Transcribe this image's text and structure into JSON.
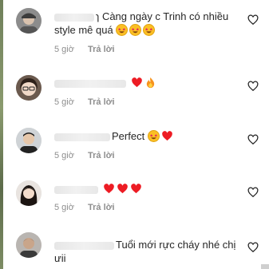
{
  "comments": [
    {
      "text": "ɿ Càng ngày c Trinh có nhiều style mê quá",
      "emojis": [
        "star-struck-emoji",
        "star-struck-emoji",
        "star-struck-emoji"
      ],
      "time": "5 giờ",
      "reply": "Trả lời",
      "avatar": "avatar-gray-cap"
    },
    {
      "text": "",
      "emojis": [
        "red-heart-emoji",
        "fire-emoji"
      ],
      "time": "5 giờ",
      "reply": "Trả lời",
      "avatar": "avatar-woman-glasses"
    },
    {
      "text": "Perfect",
      "emojis": [
        "star-struck-emoji",
        "red-heart-emoji"
      ],
      "time": "5 giờ",
      "reply": "Trả lời",
      "avatar": "avatar-man"
    },
    {
      "text": "",
      "emojis": [
        "red-heart-emoji",
        "red-heart-emoji",
        "red-heart-emoji"
      ],
      "time": "5 giờ",
      "reply": "Trả lời",
      "avatar": "avatar-woman-longhair"
    },
    {
      "text": "Tuổi mới rực cháy nhé chị ưii",
      "emojis": [],
      "time": "",
      "reply": "",
      "avatar": "avatar-man-dark"
    }
  ],
  "colors": {
    "text": "#262626",
    "meta": "#8e8e8e",
    "heart": "#ed1c24"
  }
}
